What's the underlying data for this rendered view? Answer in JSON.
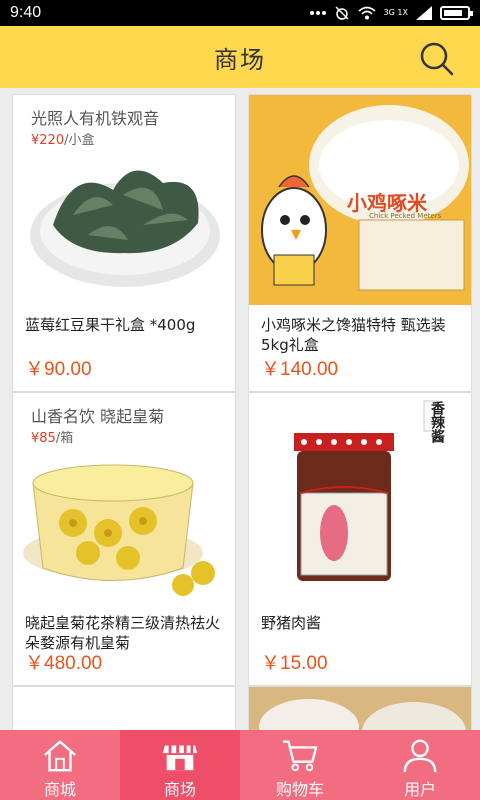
{
  "status_bar": {
    "time": "9:40",
    "network": "3G 1X"
  },
  "header": {
    "title": "商场",
    "search_icon": "search-icon"
  },
  "products": [
    {
      "image_caption": "光照人有机铁观音",
      "image_price_value": "¥220",
      "image_price_unit": "/小盒",
      "name": "蓝莓红豆果干礼盒 *400g",
      "price": "￥90.00"
    },
    {
      "image_caption": "小鸡啄米",
      "image_subcaption": "Chick Pecked Meters",
      "name": "小鸡啄米之馋猫特特 甄选装5kg礼盒",
      "price": "￥140.00"
    },
    {
      "image_caption": "山香名饮 晓起皇菊",
      "image_price_value": "¥85",
      "image_price_unit": "/箱",
      "name": "晓起皇菊花茶精三级清热祛火朵婺源有机皇菊",
      "price": "￥480.00"
    },
    {
      "image_caption": "香辣酱",
      "name": "野猪肉酱",
      "price": "￥15.00"
    }
  ],
  "tabs": [
    {
      "label": "商城",
      "icon": "home-icon",
      "active": false
    },
    {
      "label": "商场",
      "icon": "store-icon",
      "active": true
    },
    {
      "label": "购物车",
      "icon": "cart-icon",
      "active": false
    },
    {
      "label": "用户",
      "icon": "user-icon",
      "active": false
    }
  ],
  "colors": {
    "header": "#ffd84d",
    "tabbar": "#f26d80",
    "tabbar_active": "#ee4e67",
    "price": "#e8541e"
  }
}
